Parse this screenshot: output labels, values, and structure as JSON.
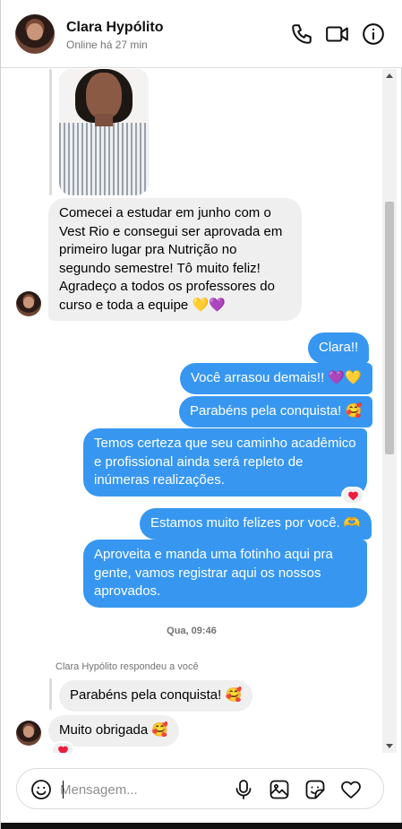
{
  "header": {
    "name": "Clara Hypólito",
    "status": "Online há 27 min",
    "icons": [
      "phone-icon",
      "video-icon",
      "info-icon"
    ]
  },
  "messages": {
    "received_1": "Comecei a estudar em junho com o Vest Rio e consegui ser aprovada em primeiro lugar pra Nutrição no segundo semestre! Tô muito feliz! Agradeço a todos os professores do curso e toda a equipe 💛💜",
    "sent": [
      "Clara!!",
      "Você arrasou demais!! 💜💛",
      "Parabéns pela conquista! 🥰",
      "Temos certeza que seu caminho acadêmico e profissional ainda será repleto de inúmeras realizações.",
      "Estamos muito felizes por você. 🫶",
      "Aproveita e manda uma fotinho aqui pra gente, vamos registrar aqui os nossos aprovados."
    ],
    "timestamp": "Qua, 09:46",
    "replied_label": "Clara Hypólito respondeu a você",
    "quoted": "Parabéns pela conquista! 🥰",
    "received_2": "Muito obrigada 🥰",
    "reaction": "❤"
  },
  "composer": {
    "placeholder": "Mensagem...",
    "icons": [
      "emoji-icon",
      "microphone-icon",
      "image-icon",
      "sticker-icon",
      "heart-icon"
    ]
  },
  "colors": {
    "accent": "#3797f0",
    "incoming": "#efefef",
    "reaction": "#ed1d3e"
  }
}
